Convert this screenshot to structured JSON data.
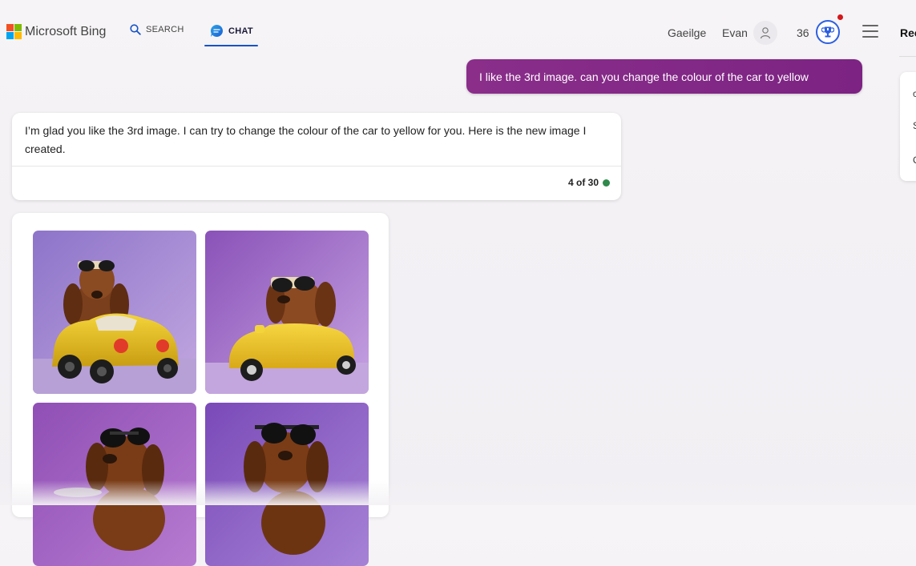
{
  "header": {
    "brand": "Microsoft Bing",
    "tabs": [
      {
        "label": "SEARCH",
        "active": false
      },
      {
        "label": "CHAT",
        "active": true
      }
    ],
    "language": "Gaeilge",
    "user_name": "Evan",
    "points": "36",
    "right_panel_title": "Rec"
  },
  "right_panel": {
    "items": [
      "c",
      "S",
      "C"
    ]
  },
  "conversation": {
    "user_message": "I like the 3rd image. can you change the colour of the car to yellow",
    "bot_message": "I’m glad you like the 3rd image. I can try to change the colour of the car to yellow for you. Here is the new image I created.",
    "turn_counter": "4 of 30"
  },
  "colors": {
    "accent_blue": "#1652c8",
    "user_bubble": "#8a2e8a",
    "status_green": "#2f8a4b",
    "notif_red": "#d4171b"
  },
  "images": [
    {
      "label": "dog-car-image-1",
      "car_color": "yellow"
    },
    {
      "label": "dog-car-image-2",
      "car_color": "yellow"
    },
    {
      "label": "dog-car-image-3"
    },
    {
      "label": "dog-car-image-4"
    }
  ]
}
